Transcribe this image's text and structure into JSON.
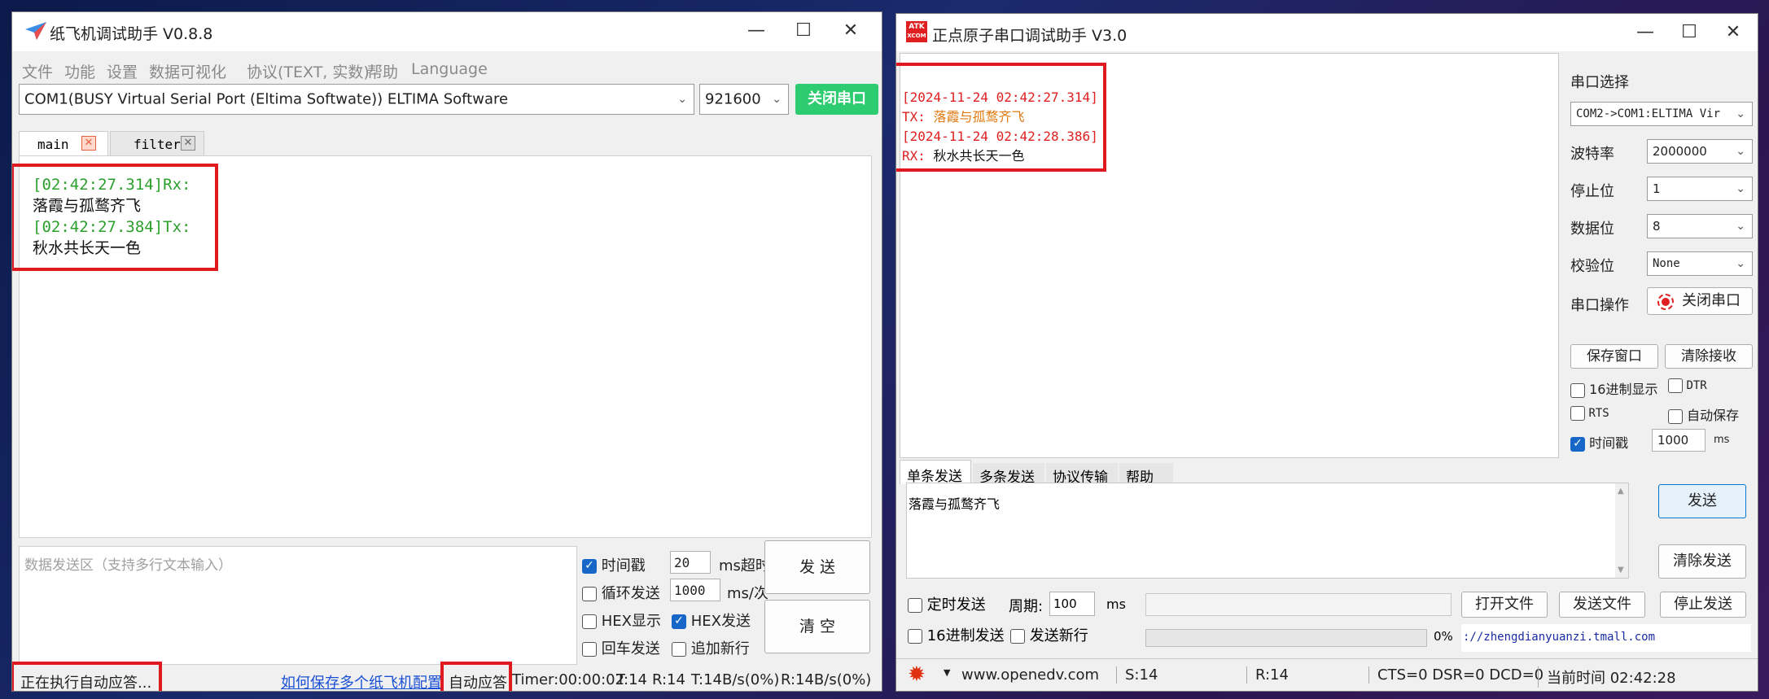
{
  "left": {
    "title": "纸飞机调试助手 V0.8.8",
    "menu": [
      "文件",
      "功能",
      "设置",
      "数据可视化",
      "协议(TEXT, 实数)",
      "帮助",
      "Language"
    ],
    "port": "COM1(BUSY  Virtual Serial Port (Eltima Softwate)) ELTIMA Software",
    "baud": "921600",
    "close_port": "关闭串口",
    "tabs": [
      {
        "label": "main"
      },
      {
        "label": "filter"
      }
    ],
    "receive": [
      {
        "text": "[02:42:27.314]Rx:",
        "color": "#2ca02c"
      },
      {
        "text": "落霞与孤鹜齐飞",
        "color": "#111111"
      },
      {
        "text": "[02:42:27.384]Tx:",
        "color": "#2ca02c"
      },
      {
        "text": "秋水共长天一色",
        "color": "#111111"
      }
    ],
    "send_placeholder": "数据发送区（支持多行文本输入）",
    "opt_timestamp": "时间戳",
    "timeout_value": "20",
    "timeout_unit": "ms超时",
    "opt_loop": "循环发送",
    "loop_value": "1000",
    "loop_unit": "ms/次",
    "opt_hex_show": "HEX显示",
    "opt_hex_send": "HEX发送",
    "opt_cr": "回车发送",
    "opt_newline": "追加新行",
    "send_btn": "发 送",
    "clear_btn": "清 空",
    "status_left": "正在执行自动应答...",
    "status_link": "如何保存多个纸飞机配置",
    "status_auto": "自动应答",
    "status_timer": "Timer:00:00:02",
    "status_t": "T:14",
    "status_r": "R:14",
    "status_tspeed": "T:14B/s(0%)",
    "status_rspeed": "R:14B/s(0%)",
    "accent": "#2ecc71"
  },
  "right": {
    "logo_top": "ATK",
    "logo_bottom": "XCOM",
    "title": "正点原子串口调试助手 V3.0",
    "receive": [
      {
        "text": "[2024-11-24 02:42:27.314]"
      },
      {
        "prefix": "TX:",
        "text": "落霞与孤鹜齐飞"
      },
      {
        "text": "[2024-11-24 02:42:28.386]"
      },
      {
        "prefix": "RX:",
        "text": "秋水共长天一色"
      }
    ],
    "port_select_label": "串口选择",
    "port_select": "COM2->COM1:ELTIMA Vir",
    "baud_label": "波特率",
    "baud": "2000000",
    "stop_label": "停止位",
    "stop": "1",
    "data_label": "数据位",
    "data": "8",
    "parity_label": "校验位",
    "parity": "None",
    "op_label": "串口操作",
    "op_btn": "关闭串口",
    "save_btn": "保存窗口",
    "clear_recv_btn": "清除接收",
    "opt_hex": "16进制显示",
    "opt_dtr": "DTR",
    "opt_rts": "RTS",
    "opt_autosave": "自动保存",
    "opt_timestamp": "时间戳",
    "ts_value": "1000",
    "ts_unit": "ms",
    "tabs": [
      {
        "label": "单条发送"
      },
      {
        "label": "多条发送"
      },
      {
        "label": "协议传输"
      },
      {
        "label": "帮助"
      }
    ],
    "send_text": "落霞与孤鹜齐飞",
    "send_btn": "发送",
    "clear_send_btn": "清除发送",
    "opt_timed": "定时发送",
    "period_label": "周期:",
    "period_value": "100",
    "period_unit": "ms",
    "open_file_btn": "打开文件",
    "send_file_btn": "发送文件",
    "stop_send_btn": "停止发送",
    "opt_hex_send": "16进制发送",
    "opt_newline": "发送新行",
    "progress": "0%",
    "progress_value": 0,
    "url": "://zhengdianyuanzi.tmall.com",
    "status_site": "www.openedv.com",
    "status_s": "S:14",
    "status_r": "R:14",
    "status_lines": "CTS=0 DSR=0 DCD=0",
    "status_time": "当前时间 02:42:28"
  }
}
